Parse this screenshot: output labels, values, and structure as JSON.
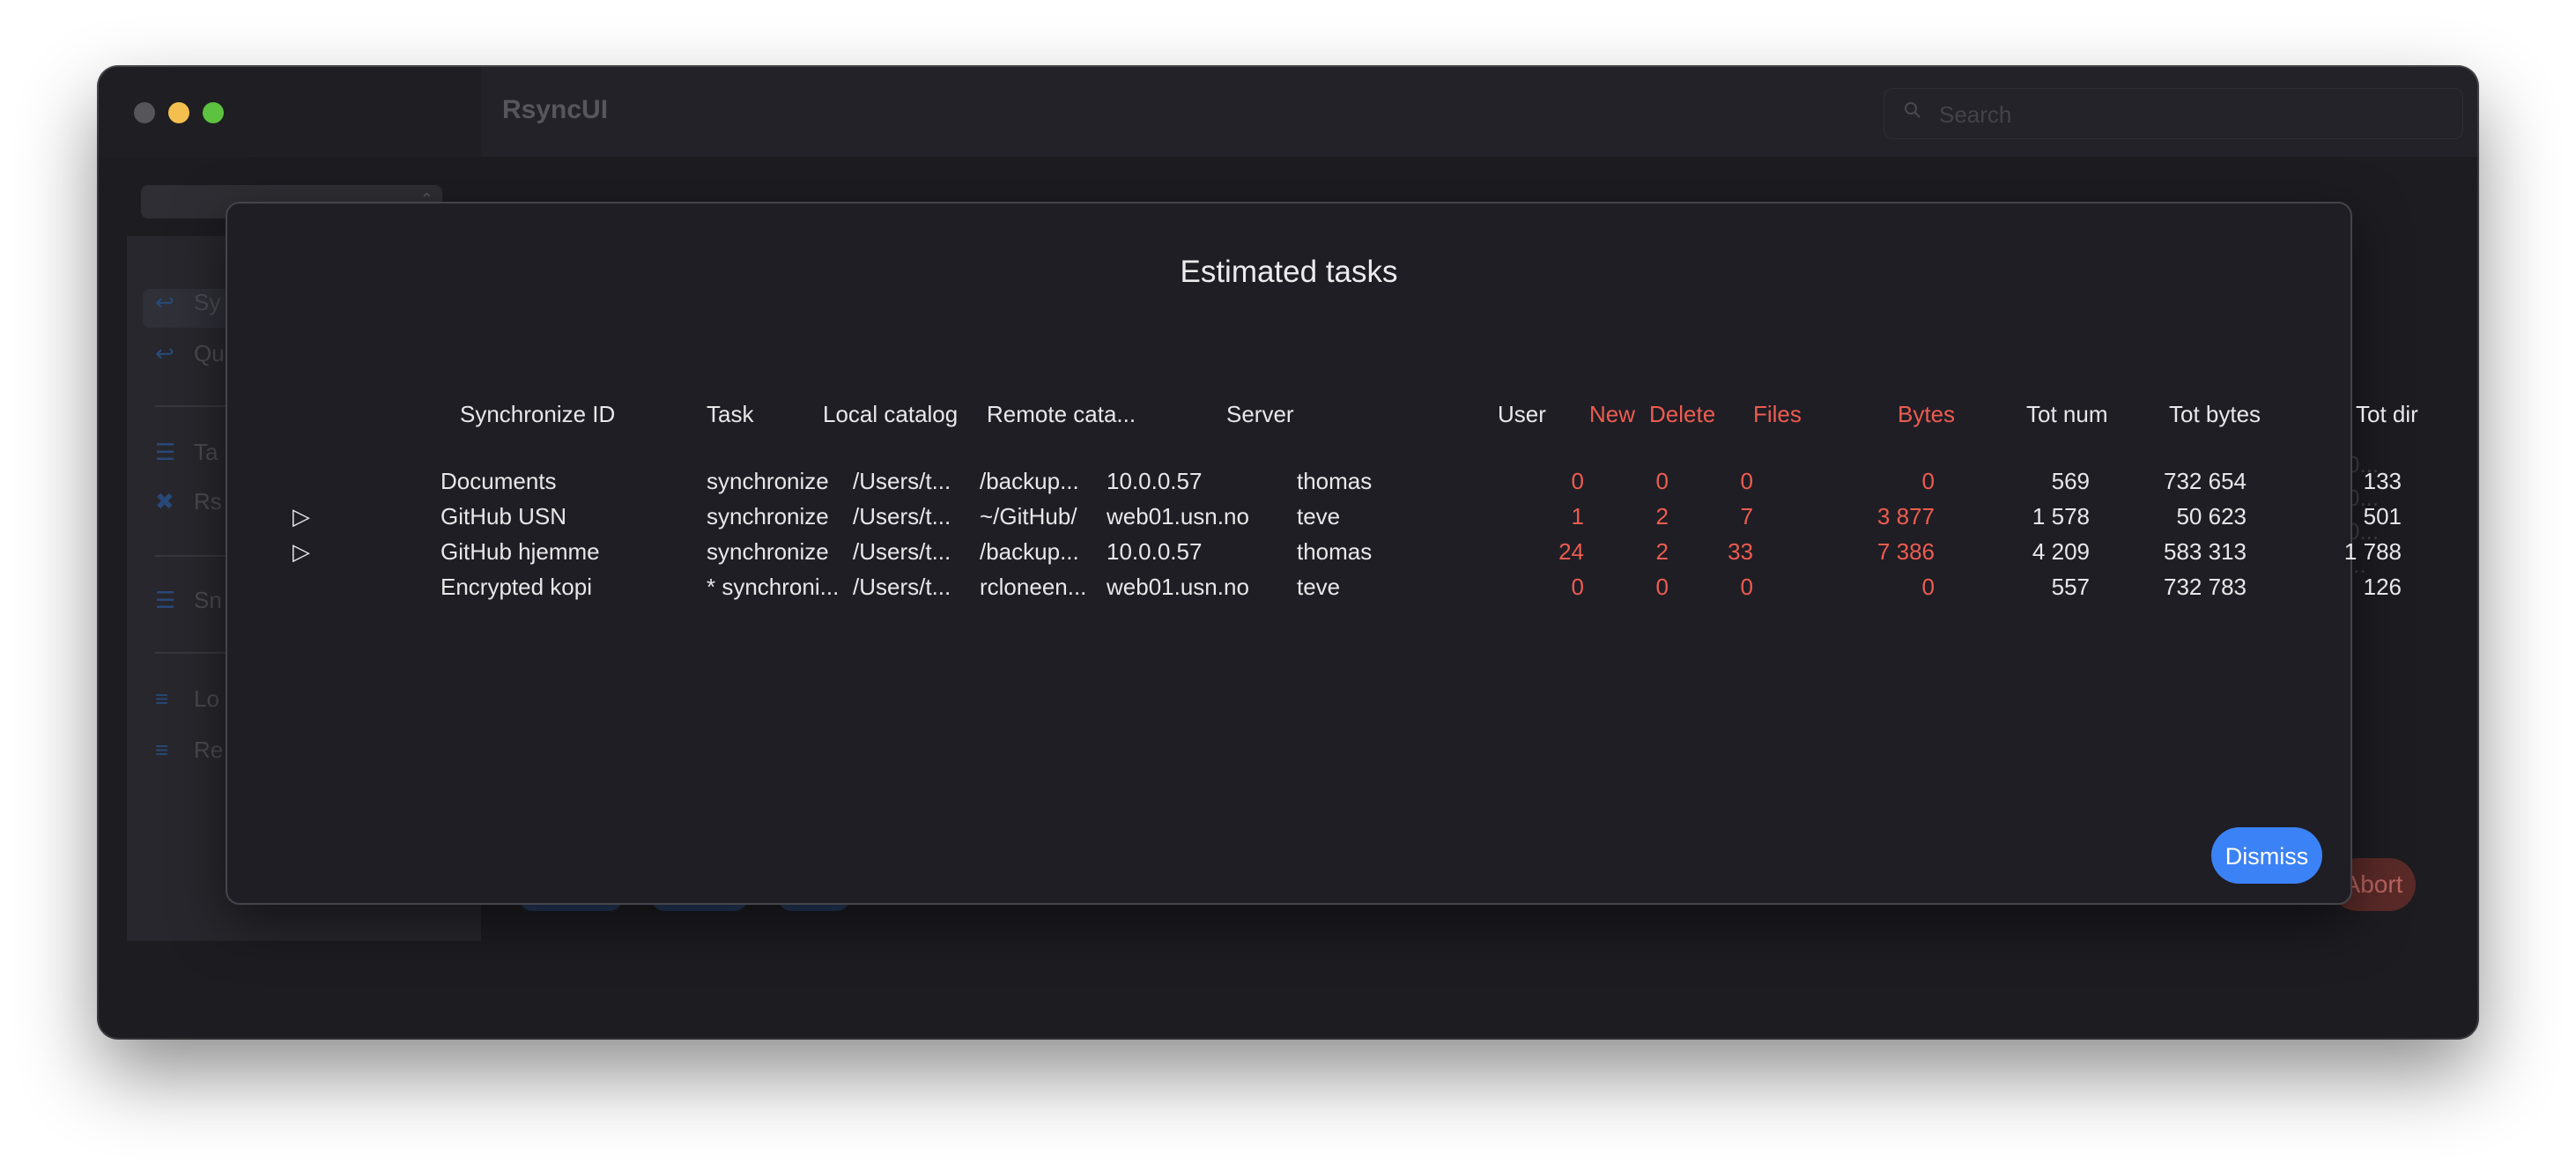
{
  "app": {
    "title": "RsyncUI"
  },
  "search": {
    "placeholder": "Search"
  },
  "sidebar": {
    "items": [
      {
        "label": "Sy",
        "icon": "synchronize-icon"
      },
      {
        "label": "Qu",
        "icon": "quick-task-icon"
      },
      {
        "label": "Ta",
        "icon": "tasks-icon"
      },
      {
        "label": "Rs",
        "icon": "rsync-parameters-icon"
      },
      {
        "label": "Sn",
        "icon": "snapshots-icon"
      },
      {
        "label": "Lo",
        "icon": "log-listings-icon"
      },
      {
        "label": "Re",
        "icon": "restore-icon"
      }
    ]
  },
  "background": {
    "abort_label": "Abort"
  },
  "modal": {
    "title": "Estimated tasks",
    "dismiss_label": "Dismiss",
    "columns": [
      "Synchronize ID",
      "Task",
      "Local catalog",
      "Remote cata...",
      "Server",
      "User",
      "New",
      "Delete",
      "Files",
      "Bytes",
      "Tot num",
      "Tot bytes",
      "Tot dir"
    ],
    "rows": [
      {
        "disclosure": "",
        "id": "Documents",
        "task": "synchronize",
        "local": "/Users/t...",
        "remote": "/backup...",
        "server": "10.0.0.57",
        "user": "thomas",
        "new": "0",
        "delete": "0",
        "files": "0",
        "bytes": "0",
        "totnum": "569",
        "totbytes": "732 654",
        "totdir": "133"
      },
      {
        "disclosure": "▷",
        "id": "GitHub USN",
        "task": "synchronize",
        "local": "/Users/t...",
        "remote": "~/GitHub/",
        "server": "web01.usn.no",
        "user": "teve",
        "new": "1",
        "delete": "2",
        "files": "7",
        "bytes": "3 877",
        "totnum": "1 578",
        "totbytes": "50 623",
        "totdir": "501"
      },
      {
        "disclosure": "▷",
        "id": "GitHub hjemme",
        "task": "synchronize",
        "local": "/Users/t...",
        "remote": "/backup...",
        "server": "10.0.0.57",
        "user": "thomas",
        "new": "24",
        "delete": "2",
        "files": "33",
        "bytes": "7 386",
        "totnum": "4 209",
        "totbytes": "583 313",
        "totdir": "1 788"
      },
      {
        "disclosure": "",
        "id": "Encrypted kopi",
        "task": "* synchroni...",
        "local": "/Users/t...",
        "remote": "rcloneen...",
        "server": "web01.usn.no",
        "user": "teve",
        "new": "0",
        "delete": "0",
        "files": "0",
        "bytes": "0",
        "totnum": "557",
        "totbytes": "732 783",
        "totdir": "126"
      }
    ]
  },
  "colors": {
    "accent": "#3b82f6",
    "estimate_red": "#ee5c50",
    "window_bg": "#1d1c21"
  }
}
